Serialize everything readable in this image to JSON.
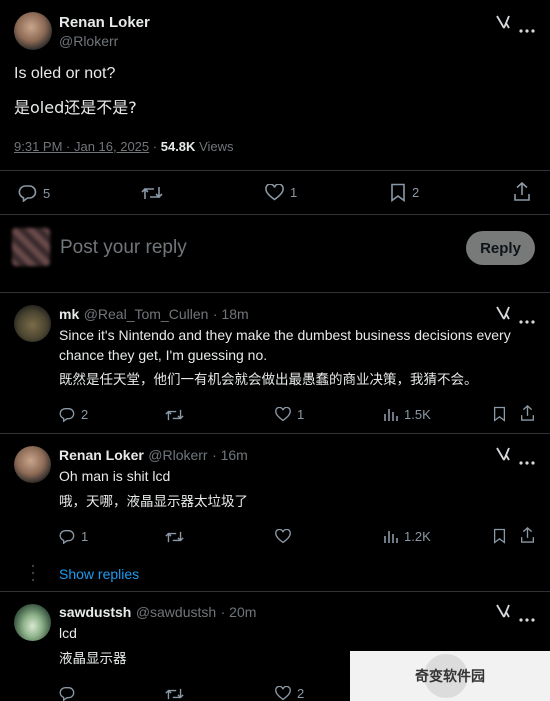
{
  "main_post": {
    "author_name": "Renan Loker",
    "author_handle": "@Rlokerr",
    "text_en": "Is oled or not?",
    "text_zh": "是oled还是不是?",
    "timestamp": "9:31 PM · Jan 16, 2025",
    "views_count": "54.8K",
    "views_label": "Views",
    "replies": "5",
    "likes": "1",
    "bookmarks": "2"
  },
  "composer": {
    "placeholder": "Post your reply",
    "reply_button": "Reply"
  },
  "replies": [
    {
      "name": "mk",
      "handle": "@Real_Tom_Cullen",
      "time": "· 18m",
      "text_en": "Since it's Nintendo and they make the dumbest business decisions every chance they get, I'm guessing no.",
      "text_zh": "既然是任天堂，他们一有机会就会做出最愚蠢的商业决策，我猜不会。",
      "replies": "2",
      "likes": "1",
      "views": "1.5K"
    },
    {
      "name": "Renan Loker",
      "handle": "@Rlokerr",
      "time": "· 16m",
      "text_en": "Oh man is shit lcd",
      "text_zh": "哦，天哪，液晶显示器太垃圾了",
      "replies": "1",
      "likes": "",
      "views": "1.2K"
    },
    {
      "name": "sawdustsh",
      "handle": "@sawdustsh",
      "time": "· 20m",
      "text_en": "lcd",
      "text_zh": "液晶显示器",
      "replies": "",
      "likes": "2",
      "views": ""
    }
  ],
  "show_replies": "Show replies",
  "watermark": "奇变软件园",
  "colors": {
    "background": "#000000",
    "accent": "#1d9bf0",
    "muted": "#71767b",
    "divider": "#2f3336",
    "reply_button_bg": "#787a7a"
  }
}
